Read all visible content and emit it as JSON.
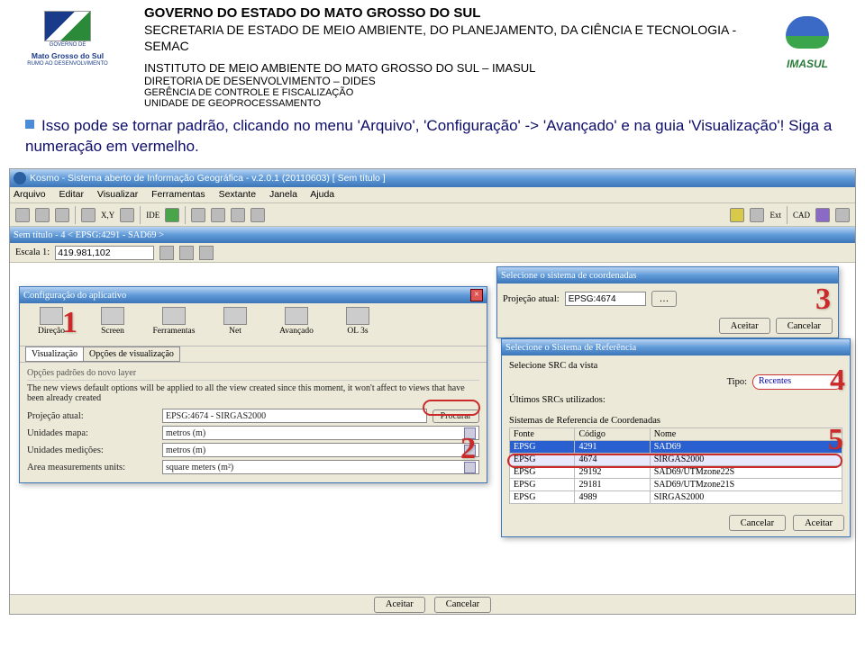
{
  "header": {
    "line1": "GOVERNO DO ESTADO DO MATO GROSSO DO SUL",
    "line2": "SECRETARIA DE ESTADO DE MEIO AMBIENTE, DO PLANEJAMENTO, DA CIÊNCIA E TECNOLOGIA - SEMAC",
    "line3": "INSTITUTO DE MEIO AMBIENTE DO MATO GROSSO DO SUL – IMASUL",
    "line4": "DIRETORIA DE DESENVOLVIMENTO – DIDES",
    "line5": "GERÊNCIA DE CONTROLE E FISCALIZAÇÃO",
    "line6": "UNIDADE DE GEOPROCESSAMENTO"
  },
  "logo_ms": {
    "main": "Mato Grosso do Sul",
    "sub": "RUMO AO DESENVOLVIMENTO",
    "gov": "GOVERNO DE"
  },
  "logo_imasul": {
    "label": "IMASUL"
  },
  "bullet_text": "Isso pode se tornar padrão, clicando no menu 'Arquivo', 'Configuração' -> 'Avançado' e na guia 'Visualização'! Siga a numeração em vermelho.",
  "app": {
    "title": "Kosmo - Sistema aberto de Informação Geográfica - v.2.0.1 (20110603)  [ Sem título ]",
    "menu": [
      "Arquivo",
      "Editar",
      "Visualizar",
      "Ferramentas",
      "Sextante",
      "Janela",
      "Ajuda"
    ],
    "view_title": "Sem título - 4 < EPSG:4291 - SAD69 >",
    "scale_label": "Escala 1:",
    "scale_value": "419.981,102",
    "buttons": {
      "aceitar": "Aceitar",
      "cancelar": "Cancelar"
    },
    "toolbar_labels": {
      "xy": "X,Y",
      "ide": "IDE",
      "plus": "+",
      "ext": "Ext",
      "cad": "CAD"
    }
  },
  "config_dialog": {
    "title": "Configuração do aplicativo",
    "tabs": [
      "Direção",
      "Screen",
      "Ferramentas",
      "Net",
      "Avançado",
      "OL 3s"
    ],
    "subtabs": [
      "Visualização",
      "Opções de visualização"
    ],
    "section": "Opções padrões do novo layer",
    "note": "The new views default options will be applied to all the view created since this moment, it won't affect to views that have been already created",
    "rows": {
      "proj_label": "Projeção atual:",
      "proj_value": "EPSG:4674 - SIRGAS2000",
      "procurar": "Procurar",
      "unid_mapa_label": "Unidades mapa:",
      "unid_mapa_value": "metros (m)",
      "unid_med_label": "Unidades medições:",
      "unid_med_value": "metros (m)",
      "area_label": "Area measurements units:",
      "area_value": "square meters (m²)"
    }
  },
  "coord_dialog": {
    "title": "Selecione o sistema de coordenadas",
    "proj_label": "Projeção atual:",
    "proj_value": "EPSG:4674",
    "browse": "…"
  },
  "src_dialog": {
    "title": "Selecione o Sistema de Referência",
    "subtitle": "Selecione SRC da vista",
    "tipo_label": "Tipo:",
    "tipo_value": "Recentes",
    "ultimos": "Últimos SRCs utilizados:",
    "section_table": "Sistemas de Referencia de Coordenadas",
    "cols": [
      "Fonte",
      "Código",
      "Nome"
    ],
    "rows": [
      {
        "fonte": "EPSG",
        "codigo": "4291",
        "nome": "SAD69",
        "sel": true
      },
      {
        "fonte": "EPSG",
        "codigo": "4674",
        "nome": "SIRGAS2000",
        "hl": true
      },
      {
        "fonte": "EPSG",
        "codigo": "29192",
        "nome": "SAD69/UTMzone22S"
      },
      {
        "fonte": "EPSG",
        "codigo": "29181",
        "nome": "SAD69/UTMzone21S"
      },
      {
        "fonte": "EPSG",
        "codigo": "4989",
        "nome": "SIRGAS2000"
      }
    ]
  },
  "annotations": {
    "n1": "1",
    "n2": "2",
    "n3": "3",
    "n4": "4",
    "n5": "5"
  }
}
